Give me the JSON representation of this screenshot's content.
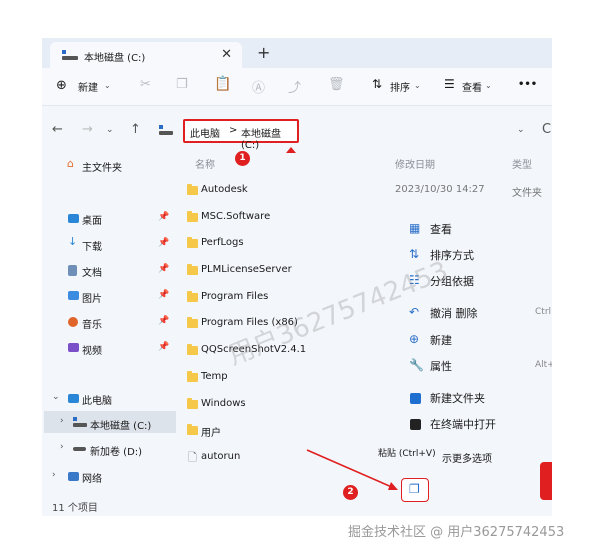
{
  "window": {
    "tab_title": "本地磁盘 (C:)"
  },
  "toolbar": {
    "new_label": "新建",
    "sort_label": "排序",
    "view_label": "查看",
    "more_label": "•••"
  },
  "address": {
    "crumb_pc": "此电脑",
    "crumb_sep": ">",
    "crumb_drive": "本地磁盘 (C:)"
  },
  "sidebar": {
    "home": "主文件夹",
    "quick": [
      {
        "label": "桌面"
      },
      {
        "label": "下载"
      },
      {
        "label": "文档"
      },
      {
        "label": "图片"
      },
      {
        "label": "音乐"
      },
      {
        "label": "视频"
      }
    ],
    "this_pc": "此电脑",
    "drive_c": "本地磁盘 (C:)",
    "drive_d": "新加卷 (D:)",
    "network": "网络"
  },
  "status": {
    "item_count": "11 个项目"
  },
  "columns": {
    "name": "名称",
    "modified": "修改日期",
    "type": "类型"
  },
  "files": [
    {
      "name": "Autodesk",
      "date": "2023/10/30 14:27",
      "type": "文件夹"
    },
    {
      "name": "MSC.Software"
    },
    {
      "name": "PerfLogs"
    },
    {
      "name": "PLMLicenseServer"
    },
    {
      "name": "Program Files"
    },
    {
      "name": "Program Files (x86)"
    },
    {
      "name": "QQScreenShotV2.4.1"
    },
    {
      "name": "Temp"
    },
    {
      "name": "Windows"
    },
    {
      "name": "用户"
    },
    {
      "name": "autorun"
    }
  ],
  "context_menu": {
    "view": "查看",
    "sort": "排序方式",
    "group": "分组依据",
    "undo": "撤消 删除",
    "undo_shortcut": "Ctrl",
    "new": "新建",
    "properties": "属性",
    "properties_shortcut": "Alt+",
    "new_folder": "新建文件夹",
    "terminal": "在终端中打开",
    "more": "示更多选项",
    "paste_tooltip": "粘贴 (Ctrl+V)"
  },
  "annotations": {
    "badge1": "1",
    "badge2": "2"
  },
  "watermark": "用户36275742453",
  "footer": "掘金技术社区 @ 用户36275742453",
  "colors": {
    "accent_red": "#e02020",
    "folder": "#f5c84a",
    "drive_blue": "#2b6cc4"
  }
}
